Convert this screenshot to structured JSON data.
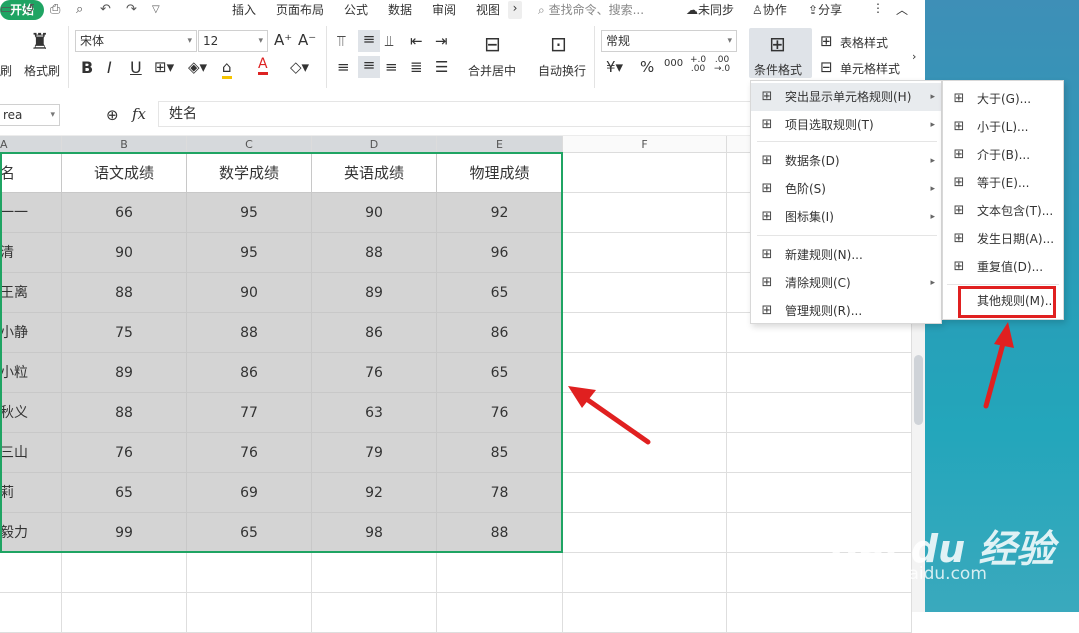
{
  "tabs": {
    "start": "开始",
    "insert": "插入",
    "page_layout": "页面布局",
    "formula": "公式",
    "data": "数据",
    "review": "审阅",
    "view": "视图",
    "more": "›"
  },
  "search": {
    "placeholder": "查找命令、搜索..."
  },
  "header_right": {
    "sync": "未同步",
    "collab": "协作",
    "share": "分享",
    "more": "⋮",
    "collapse": "︿"
  },
  "ribbon": {
    "format_painter": "格式刷",
    "font_name": "宋体",
    "font_size": "12",
    "number_format": "常规",
    "merge_center": "合并居中",
    "wrap_text": "自动换行",
    "cond_format": "条件格式",
    "table_style": "表格样式",
    "cell_style": "单元格样式",
    "bold": "B",
    "italic": "I",
    "underline": "U",
    "currency": "¥",
    "percent": "%",
    "thousands": "000",
    "inc_dec": "+.0\n.00",
    "dec_dec": ".00\n→.0"
  },
  "formula_bar": {
    "name_box": "rea",
    "fx": "fx",
    "content": "姓名"
  },
  "columns": [
    "A",
    "B",
    "C",
    "D",
    "E",
    "F"
  ],
  "table": {
    "headers": [
      "名",
      "语文成绩",
      "数学成绩",
      "英语成绩",
      "物理成绩"
    ],
    "rows": [
      [
        "一一",
        "66",
        "95",
        "90",
        "92"
      ],
      [
        "清",
        "90",
        "95",
        "88",
        "96"
      ],
      [
        "王离",
        "88",
        "90",
        "89",
        "65"
      ],
      [
        "小静",
        "75",
        "88",
        "86",
        "86"
      ],
      [
        "小粒",
        "89",
        "86",
        "76",
        "65"
      ],
      [
        "秋义",
        "88",
        "77",
        "63",
        "76"
      ],
      [
        "三山",
        "76",
        "76",
        "79",
        "85"
      ],
      [
        "莉",
        "65",
        "69",
        "92",
        "78"
      ],
      [
        "毅力",
        "99",
        "65",
        "98",
        "88"
      ]
    ]
  },
  "cond_menu": [
    {
      "label": "突出显示单元格规则(H)",
      "icon": "highlight-rules-icon",
      "sub": true
    },
    {
      "label": "项目选取规则(T)",
      "icon": "top-bottom-icon",
      "sub": true
    },
    {
      "label": "数据条(D)",
      "icon": "data-bars-icon",
      "sub": true
    },
    {
      "label": "色阶(S)",
      "icon": "color-scale-icon",
      "sub": true
    },
    {
      "label": "图标集(I)",
      "icon": "icon-sets-icon",
      "sub": true
    },
    {
      "label": "新建规则(N)...",
      "icon": "new-rule-icon",
      "sub": false
    },
    {
      "label": "清除规则(C)",
      "icon": "clear-rules-icon",
      "sub": true
    },
    {
      "label": "管理规则(R)...",
      "icon": "manage-rules-icon",
      "sub": false
    }
  ],
  "sub_menu": [
    {
      "label": "大于(G)...",
      "icon": "greater-than-icon"
    },
    {
      "label": "小于(L)...",
      "icon": "less-than-icon"
    },
    {
      "label": "介于(B)...",
      "icon": "between-icon"
    },
    {
      "label": "等于(E)...",
      "icon": "equal-to-icon"
    },
    {
      "label": "文本包含(T)...",
      "icon": "text-contains-icon"
    },
    {
      "label": "发生日期(A)...",
      "icon": "date-occurring-icon"
    },
    {
      "label": "重复值(D)...",
      "icon": "duplicate-values-icon"
    },
    {
      "label": "其他规则(M)...",
      "icon": ""
    }
  ],
  "watermark": {
    "brand": "Bai du 经验",
    "url": "jingyan.baidu.com"
  },
  "colors": {
    "accent": "#1fa463",
    "annotation": "#e02020"
  }
}
